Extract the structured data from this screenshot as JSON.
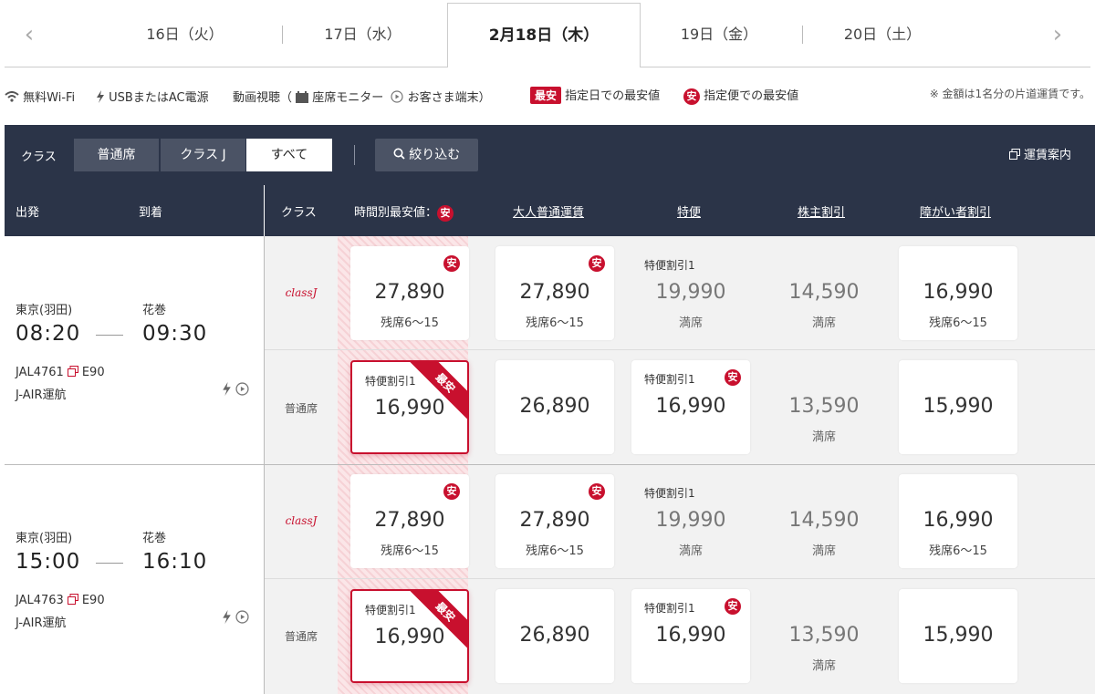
{
  "dates": {
    "prev_arrow": "‹",
    "next_arrow": "›",
    "tabs": [
      "16日（火）",
      "17日（水）",
      "2月18日（木）",
      "19日（金）",
      "20日（土）"
    ]
  },
  "legend": {
    "wifi": "無料Wi-Fi",
    "power": "USBまたはAC電源",
    "video_prefix": "動画視聴（",
    "seat_monitor": "座席モニター",
    "customer_device": "お客さま端末）",
    "best_badge": "最安",
    "best_day": "指定日での最安値",
    "yasu_badge": "安",
    "best_flight": "指定便での最安値",
    "note": "※ 金額は1名分の片道運賃です。"
  },
  "filter": {
    "label": "クラス",
    "options": [
      "普通席",
      "クラス J",
      "すべて"
    ],
    "selected": "すべて",
    "narrow_button": "絞り込む",
    "fare_guide": "運賃案内"
  },
  "header": {
    "depart": "出発",
    "arrive": "到着",
    "class": "クラス",
    "lowest_by_time": "時間別最安値：",
    "lowest_badge": "安",
    "col_adult": "大人普通運賃",
    "col_special": "特便",
    "col_shareholder": "株主割引",
    "col_disability": "障がい者割引"
  },
  "flights": [
    {
      "from": "東京(羽田)",
      "to": "花巻",
      "dep": "08:20",
      "arr": "09:30",
      "flight_no": "JAL4761",
      "aircraft": "E90",
      "operator": "J-AIR運航",
      "rows": [
        {
          "class_label": "classJ",
          "c0": {
            "sub": "",
            "price": "27,890",
            "seat": "残席6～15",
            "yasu": "安"
          },
          "c1": {
            "sub": "",
            "price": "27,890",
            "seat": "残席6～15",
            "yasu": "安"
          },
          "c2": {
            "sub": "特便割引1",
            "price": "19,990",
            "seat": "満席"
          },
          "c3": {
            "price": "14,590",
            "seat": "満席"
          },
          "c4": {
            "price": "16,990",
            "seat": "残席6～15"
          }
        },
        {
          "class_label": "普通席",
          "c0": {
            "sub": "特便割引1",
            "price": "16,990",
            "ribbon": "最安"
          },
          "c1": {
            "price": "26,890"
          },
          "c2": {
            "sub": "特便割引1",
            "price": "16,990",
            "yasu": "安"
          },
          "c3": {
            "price": "13,590",
            "seat": "満席"
          },
          "c4": {
            "price": "15,990"
          }
        }
      ]
    },
    {
      "from": "東京(羽田)",
      "to": "花巻",
      "dep": "15:00",
      "arr": "16:10",
      "flight_no": "JAL4763",
      "aircraft": "E90",
      "operator": "J-AIR運航",
      "rows": [
        {
          "class_label": "classJ",
          "c0": {
            "sub": "",
            "price": "27,890",
            "seat": "残席6～15",
            "yasu": "安"
          },
          "c1": {
            "sub": "",
            "price": "27,890",
            "seat": "残席6～15",
            "yasu": "安"
          },
          "c2": {
            "sub": "特便割引1",
            "price": "19,990",
            "seat": "満席"
          },
          "c3": {
            "price": "14,590",
            "seat": "満席"
          },
          "c4": {
            "price": "16,990",
            "seat": "残席6～15"
          }
        },
        {
          "class_label": "普通席",
          "c0": {
            "sub": "特便割引1",
            "price": "16,990",
            "ribbon": "最安"
          },
          "c1": {
            "price": "26,890"
          },
          "c2": {
            "sub": "特便割引1",
            "price": "16,990",
            "yasu": "安"
          },
          "c3": {
            "price": "13,590",
            "seat": "満席"
          },
          "c4": {
            "price": "15,990"
          }
        }
      ]
    }
  ],
  "colors": {
    "accent_red": "#c8102e",
    "navy": "#2b3448"
  }
}
